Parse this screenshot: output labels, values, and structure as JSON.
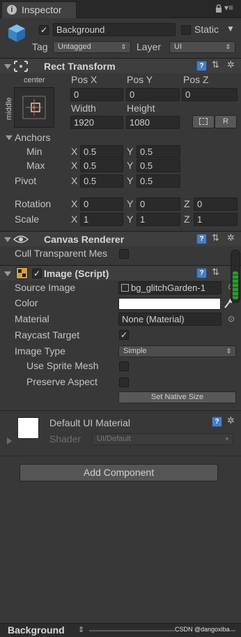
{
  "tab": {
    "title": "Inspector"
  },
  "gameobject": {
    "name": "Background",
    "static_label": "Static",
    "tag_label": "Tag",
    "tag_value": "Untagged",
    "layer_label": "Layer",
    "layer_value": "UI"
  },
  "rect_transform": {
    "title": "Rect Transform",
    "anchor_h": "center",
    "anchor_v": "middle",
    "pos_x_label": "Pos X",
    "pos_y_label": "Pos Y",
    "pos_z_label": "Pos Z",
    "pos_x": "0",
    "pos_y": "0",
    "pos_z": "0",
    "width_label": "Width",
    "height_label": "Height",
    "width": "1920",
    "height": "1080",
    "raw_button": "R",
    "anchors_label": "Anchors",
    "min_label": "Min",
    "max_label": "Max",
    "min_x": "0.5",
    "min_y": "0.5",
    "max_x": "0.5",
    "max_y": "0.5",
    "pivot_label": "Pivot",
    "pivot_x": "0.5",
    "pivot_y": "0.5",
    "rotation_label": "Rotation",
    "rot_x": "0",
    "rot_y": "0",
    "rot_z": "0",
    "scale_label": "Scale",
    "scale_x": "1",
    "scale_y": "1",
    "scale_z": "1",
    "x": "X",
    "y": "Y",
    "z": "Z"
  },
  "canvas_renderer": {
    "title": "Canvas Renderer",
    "cull_label": "Cull Transparent Mes"
  },
  "image": {
    "title": "Image (Script)",
    "source_label": "Source Image",
    "source_value": "bg_glitchGarden-1",
    "color_label": "Color",
    "color_value": "#ffffff",
    "material_label": "Material",
    "material_value": "None (Material)",
    "raycast_label": "Raycast Target",
    "image_type_label": "Image Type",
    "image_type_value": "Simple",
    "sprite_mesh_label": "Use Sprite Mesh",
    "preserve_label": "Preserve Aspect",
    "native_button": "Set Native Size"
  },
  "material_preview": {
    "name": "Default UI Material",
    "shader_label": "Shader",
    "shader_value": "UI/Default"
  },
  "add_component": "Add Component",
  "footer": {
    "selection": "Background",
    "watermark": "CSDN @dangoxiba"
  }
}
